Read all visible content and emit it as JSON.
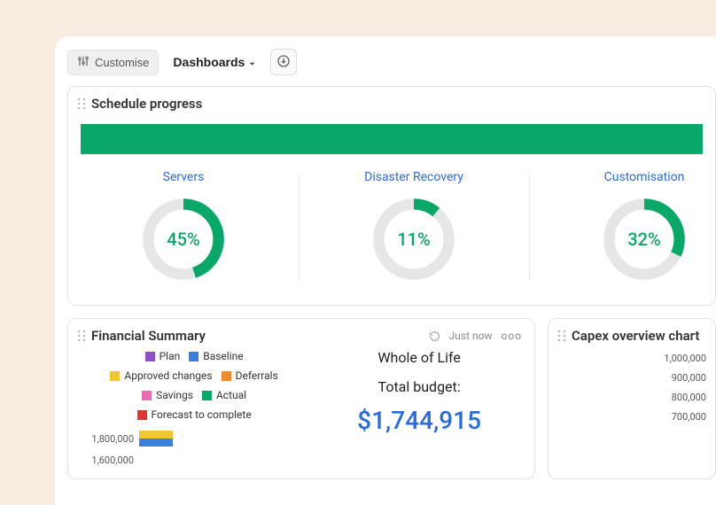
{
  "toolbar": {
    "customise_label": "Customise",
    "dashboards_label": "Dashboards"
  },
  "schedule_card": {
    "title": "Schedule progress",
    "donuts": [
      {
        "label": "Servers",
        "pct": 45,
        "pct_text": "45%"
      },
      {
        "label": "Disaster Recovery",
        "pct": 11,
        "pct_text": "11%"
      },
      {
        "label": "Customisation",
        "pct": 32,
        "pct_text": "32%"
      }
    ]
  },
  "financial_card": {
    "title": "Financial Summary",
    "refresh_text": "Just now",
    "legend": [
      {
        "label": "Plan",
        "color": "#8f4fc9"
      },
      {
        "label": "Baseline",
        "color": "#3a7fe0"
      },
      {
        "label": "Approved changes",
        "color": "#f2c531"
      },
      {
        "label": "Deferrals",
        "color": "#f08a2c"
      },
      {
        "label": "Savings",
        "color": "#e86db0"
      },
      {
        "label": "Actual",
        "color": "#0aa868"
      },
      {
        "label": "Forecast to complete",
        "color": "#e1352f"
      }
    ],
    "yticks": [
      "1,800,000",
      "1,600,000"
    ],
    "whole_of_life_title": "Whole of Life",
    "whole_of_life_sub": "Total budget:",
    "whole_of_life_amount": "$1,744,915"
  },
  "capex_card": {
    "title": "Capex overview chart",
    "yticks": [
      "1,000,000",
      "900,000",
      "800,000",
      "700,000"
    ]
  },
  "colors": {
    "accent_green": "#0aa868",
    "link_blue": "#2b6cd9"
  },
  "chart_data": [
    {
      "type": "pie",
      "title": "Servers",
      "series": [
        {
          "name": "progress",
          "values": [
            45
          ]
        }
      ]
    },
    {
      "type": "pie",
      "title": "Disaster Recovery",
      "series": [
        {
          "name": "progress",
          "values": [
            11
          ]
        }
      ]
    },
    {
      "type": "pie",
      "title": "Customisation",
      "series": [
        {
          "name": "progress",
          "values": [
            32
          ]
        }
      ]
    },
    {
      "type": "bar",
      "title": "Financial Summary",
      "ylim": [
        0,
        1800000
      ],
      "series": [
        {
          "name": "Plan",
          "values": []
        },
        {
          "name": "Baseline",
          "values": []
        },
        {
          "name": "Approved changes",
          "values": []
        },
        {
          "name": "Deferrals",
          "values": []
        },
        {
          "name": "Savings",
          "values": []
        },
        {
          "name": "Actual",
          "values": []
        },
        {
          "name": "Forecast to complete",
          "values": []
        }
      ]
    },
    {
      "type": "bar",
      "title": "Capex overview chart",
      "ylim": [
        0,
        1000000
      ],
      "series": []
    }
  ]
}
